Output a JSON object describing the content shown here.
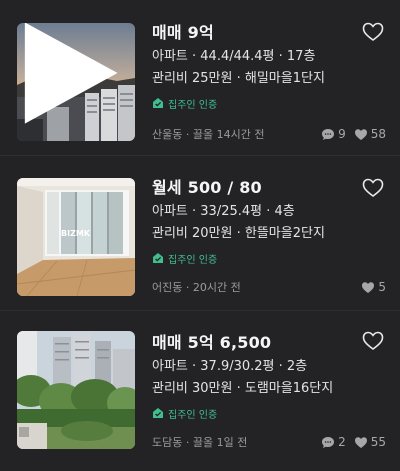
{
  "listings": [
    {
      "title": "매매 9억",
      "details": "아파트 · 44.4/44.4평 · 17층",
      "fee": "관리비 25만원 · 해밀마을1단지",
      "badge": "집주인 인증",
      "location_time": "산울동 · 끌올 14시간 전",
      "comments": "9",
      "likes": "58",
      "image": "sunset-city-view",
      "has_video": true
    },
    {
      "title": "월세 500 / 80",
      "details": "아파트 · 33/25.4평 · 4층",
      "fee": "관리비 20만원 · 한뜰마을2단지",
      "badge": "집주인 인증",
      "location_time": "어진동 · 20시간 전",
      "comments": "",
      "likes": "5",
      "image": "empty-room-interior",
      "watermark": "BIZMK",
      "has_video": false
    },
    {
      "title": "매매 5억 6,500",
      "details": "아파트 · 37.9/30.2평 · 2층",
      "fee": "관리비 30만원 · 도램마을16단지",
      "badge": "집주인 인증",
      "location_time": "도담동 · 끌올 1일 전",
      "comments": "2",
      "likes": "55",
      "image": "apartment-trees-exterior",
      "has_video": false
    }
  ],
  "colors": {
    "background": "#232325",
    "verified_green": "#3fbf8f",
    "meta_gray": "#9b9b9f"
  },
  "icons": [
    "heart-outline-icon",
    "comment-icon",
    "heart-filled-icon",
    "verified-home-icon",
    "play-icon"
  ]
}
